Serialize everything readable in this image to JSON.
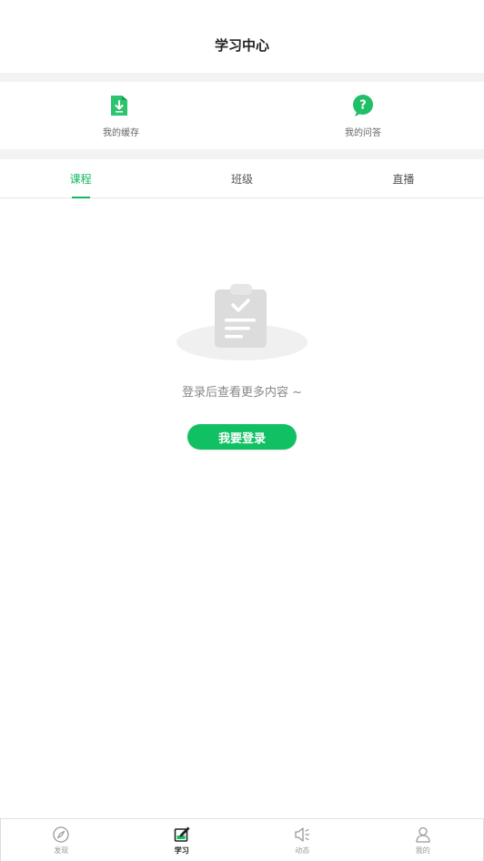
{
  "header": {
    "title": "学习中心"
  },
  "shortcuts": [
    {
      "label": "我的缓存",
      "icon": "download-folder-icon"
    },
    {
      "label": "我的问答",
      "icon": "question-bubble-icon"
    }
  ],
  "tabs": [
    {
      "label": "课程",
      "active": true
    },
    {
      "label": "班级",
      "active": false
    },
    {
      "label": "直播",
      "active": false
    }
  ],
  "empty_state": {
    "message": "登录后查看更多内容 ~",
    "button_label": "我要登录",
    "icon": "clipboard-check-icon"
  },
  "tabbar": [
    {
      "label": "发现",
      "icon": "compass-icon",
      "active": false
    },
    {
      "label": "学习",
      "icon": "study-edit-icon",
      "active": true
    },
    {
      "label": "动态",
      "icon": "speaker-icon",
      "active": false
    },
    {
      "label": "我的",
      "icon": "user-icon",
      "active": false
    }
  ],
  "colors": {
    "accent": "#11c063",
    "tab_active": "#11b963",
    "background_gap": "#f3f3f3"
  }
}
